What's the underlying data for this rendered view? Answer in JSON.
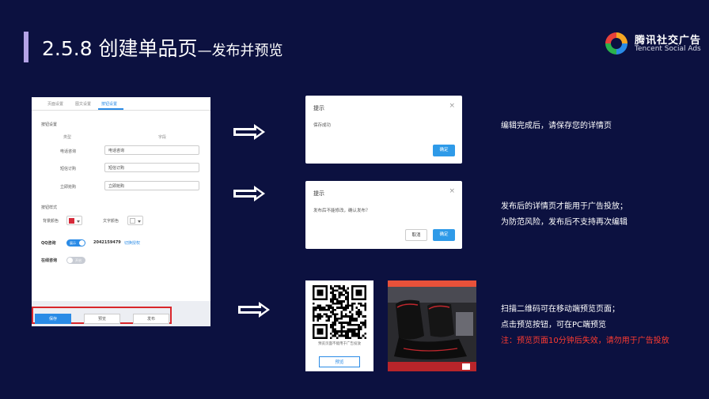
{
  "header": {
    "title_main": "2.5.8 创建单品页",
    "title_sub": "—发布并预览",
    "logo_cn": "腾讯社交广告",
    "logo_en": "Tencent Social Ads"
  },
  "form": {
    "tabs": [
      "页面设置",
      "图文设置",
      "按钮设置"
    ],
    "section_settings": "按钮设置",
    "col_type": "类型",
    "col_field": "字段",
    "rows": [
      {
        "label": "电话咨询",
        "value": "电话咨询"
      },
      {
        "label": "短信订购",
        "value": "短信订购"
      },
      {
        "label": "立即抢购",
        "value": "立即抢购"
      }
    ],
    "section_style": "按钮样式",
    "bg_color_label": "背景颜色",
    "text_color_label": "文字颜色",
    "qq_label": "QQ咨询",
    "qq_toggle_text": "展示",
    "qq_number": "2042159479",
    "qq_link": "切换授权",
    "online_label": "在线咨询",
    "online_toggle_text": "开启",
    "btn_save": "保存",
    "btn_preview": "预览",
    "btn_publish": "发布"
  },
  "dialog1": {
    "title": "提示",
    "close": "×",
    "body": "保存成功",
    "confirm": "确定"
  },
  "dialog2": {
    "title": "提示",
    "close": "×",
    "body": "发布后不能修改，确认发布？",
    "cancel": "取消",
    "confirm": "确定"
  },
  "desc1": "编辑完成后，请保存您的详情页",
  "desc2": {
    "line1": "发布后的详情页才能用于广告投放；",
    "line2": "为防范风险，发布后不支持再次编辑"
  },
  "desc3": {
    "line1": "扫描二维码可在移动端预览页面；",
    "line2": "点击预览按钮，可在PC端预览",
    "line3": "注：预览页面10分钟后失效，请勿用于广告投放"
  },
  "preview": {
    "qr_note": "预览页面不能用于广告投放",
    "qr_button": "预览"
  },
  "colors": {
    "background": "#0c1140",
    "accent_blue": "#2a8be6",
    "warning_red": "#ff3b30",
    "bg_swatch": "#d62a3a"
  }
}
